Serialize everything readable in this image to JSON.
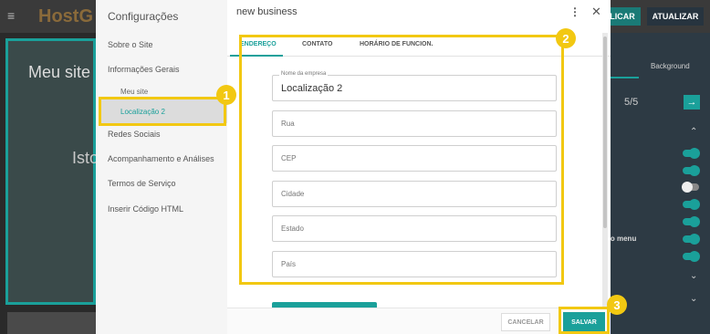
{
  "background_app": {
    "logo": "HostG",
    "publicar_label": "LICAR",
    "atualizar_label": "ATUALIZAR",
    "hero_title": "Meu site",
    "hero_subtitle": "Isto",
    "right_panel": {
      "tab_background": "Background",
      "pager": "5/5",
      "menu_label": "no menu"
    }
  },
  "sidebar": {
    "title": "Configurações",
    "items": [
      {
        "label": "Sobre o Site"
      },
      {
        "label": "Informações Gerais"
      },
      {
        "label": "Meu site"
      },
      {
        "label": "Localização 2"
      },
      {
        "label": "Redes Sociais"
      },
      {
        "label": "Acompanhamento e Análises"
      },
      {
        "label": "Termos de Serviço"
      },
      {
        "label": "Inserir Código HTML"
      }
    ]
  },
  "modal": {
    "title": "new business",
    "tabs": [
      {
        "label": "ENDEREÇO",
        "active": true
      },
      {
        "label": "CONTATO",
        "active": false
      },
      {
        "label": "HORÁRIO DE FUNCION.",
        "active": false
      }
    ],
    "fields": {
      "business_name_label": "Nome da empresa",
      "business_name_value": "Localização 2",
      "street_placeholder": "Rua",
      "zip_placeholder": "CEP",
      "city_placeholder": "Cidade",
      "state_placeholder": "Estado",
      "country_placeholder": "País"
    },
    "footer": {
      "cancel_label": "CANCELAR",
      "save_label": "SALVAR"
    }
  },
  "callouts": {
    "one": "1",
    "two": "2",
    "three": "3"
  },
  "colors": {
    "accent": "#1aa09a",
    "highlight": "#f2c812"
  }
}
